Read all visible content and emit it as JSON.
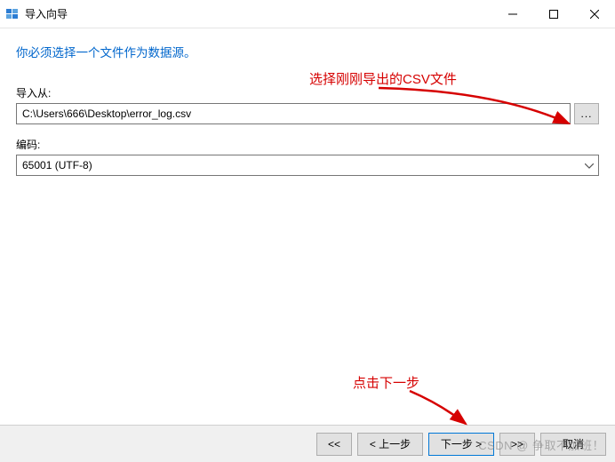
{
  "window": {
    "title": "导入向导"
  },
  "instruction": "你必须选择一个文件作为数据源。",
  "annotations": {
    "select_csv": "选择刚刚导出的CSV文件",
    "click_next": "点击下一步"
  },
  "fields": {
    "import_from": {
      "label": "导入从:",
      "value": "C:\\Users\\666\\Desktop\\error_log.csv"
    },
    "encoding": {
      "label": "编码:",
      "value": "65001 (UTF-8)"
    }
  },
  "buttons": {
    "browse": "...",
    "first": "<<",
    "prev": "< 上一步",
    "next": "下一步 >",
    "last": ">>",
    "cancel": "取消"
  },
  "watermark": "CSDN @ 争取不加班！"
}
